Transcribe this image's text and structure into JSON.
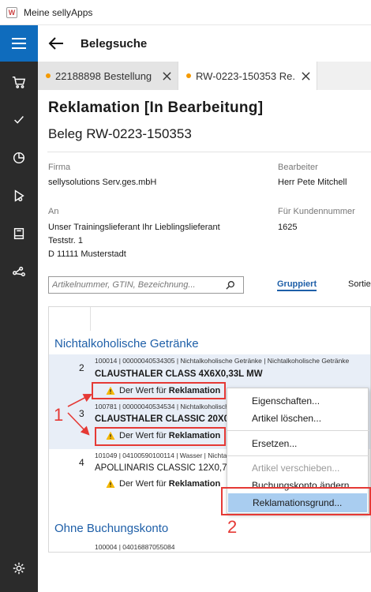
{
  "window": {
    "title": "Meine sellyApps"
  },
  "header": {
    "title": "Belegsuche"
  },
  "tabs": [
    {
      "label": "22188898 Bestellung",
      "dot_color": "#f59a00"
    },
    {
      "label": "RW-0223-150353 Re...",
      "dot_color": "#f59a00"
    }
  ],
  "doc": {
    "title": "Reklamation [In Bearbeitung]",
    "subtitle": "Beleg RW-0223-150353",
    "firma_label": "Firma",
    "firma_value": "sellysolutions Serv.ges.mbH",
    "bearbeiter_label": "Bearbeiter",
    "bearbeiter_value": "Herr Pete Mitchell",
    "an_label": "An",
    "an_line1": "Unser Trainingslieferant Ihr Lieblingslieferant",
    "an_line2": "Teststr. 1",
    "an_line3": "D 11111 Musterstadt",
    "kunden_label": "Für Kundennummer",
    "kunden_value": "1625"
  },
  "search": {
    "placeholder": "Artikelnummer, GTIN, Bezeichnung..."
  },
  "view": {
    "grouped_label": "Gruppiert",
    "sort_label": "Sortie"
  },
  "groups": [
    {
      "title": "Nichtalkoholische Getränke"
    },
    {
      "title": "Ohne Buchungskonto"
    }
  ],
  "rows": [
    {
      "num": "2",
      "meta": "100014 | 00000040534305 | Nichtalkoholische Getränke | Nichtalkoholische Getränke",
      "name": "CLAUSTHALER CLASS 4X6X0,33L MW",
      "warn_prefix": "Der Wert für",
      "warn_bold": "Reklamation"
    },
    {
      "num": "3",
      "meta": "100781 | 00000040534534 | Nichtalkoholische Getränke | Nichtalkoholische Getränke",
      "name": "CLAUSTHALER CLASSIC 20X0,5",
      "warn_prefix": "Der Wert für",
      "warn_bold": "Reklamation"
    },
    {
      "num": "4",
      "meta": "101049 | 04100590100114 | Wasser | Nichtalkoholische Getränke",
      "name": "APOLLINARIS CLASSIC 12X0,7L",
      "warn_prefix": "Der Wert für",
      "warn_bold": "Reklamation"
    },
    {
      "num": "",
      "meta": "100004 | 04016887055084",
      "name": "",
      "warn_prefix": "",
      "warn_bold": ""
    }
  ],
  "context_menu": {
    "items": [
      {
        "label": "Eigenschaften..."
      },
      {
        "label": "Artikel löschen..."
      },
      {
        "label": "Ersetzen..."
      },
      {
        "label": "Artikel verschieben..."
      },
      {
        "label": "Buchungskonto ändern..."
      },
      {
        "label": "Reklamationsgrund..."
      }
    ]
  },
  "annotations": {
    "marker1": "1",
    "marker2": "2",
    "color": "#e53935"
  },
  "colors": {
    "accent": "#0f6cbd",
    "sidebar": "#2b2b2b",
    "link": "#1e5fa8",
    "warning": "#f5b800"
  },
  "icons": {
    "sidebar": [
      "menu-icon",
      "cart-icon",
      "check-icon",
      "pie-chart-icon",
      "route-icon",
      "book-icon",
      "share-icon",
      "gear-icon"
    ]
  }
}
